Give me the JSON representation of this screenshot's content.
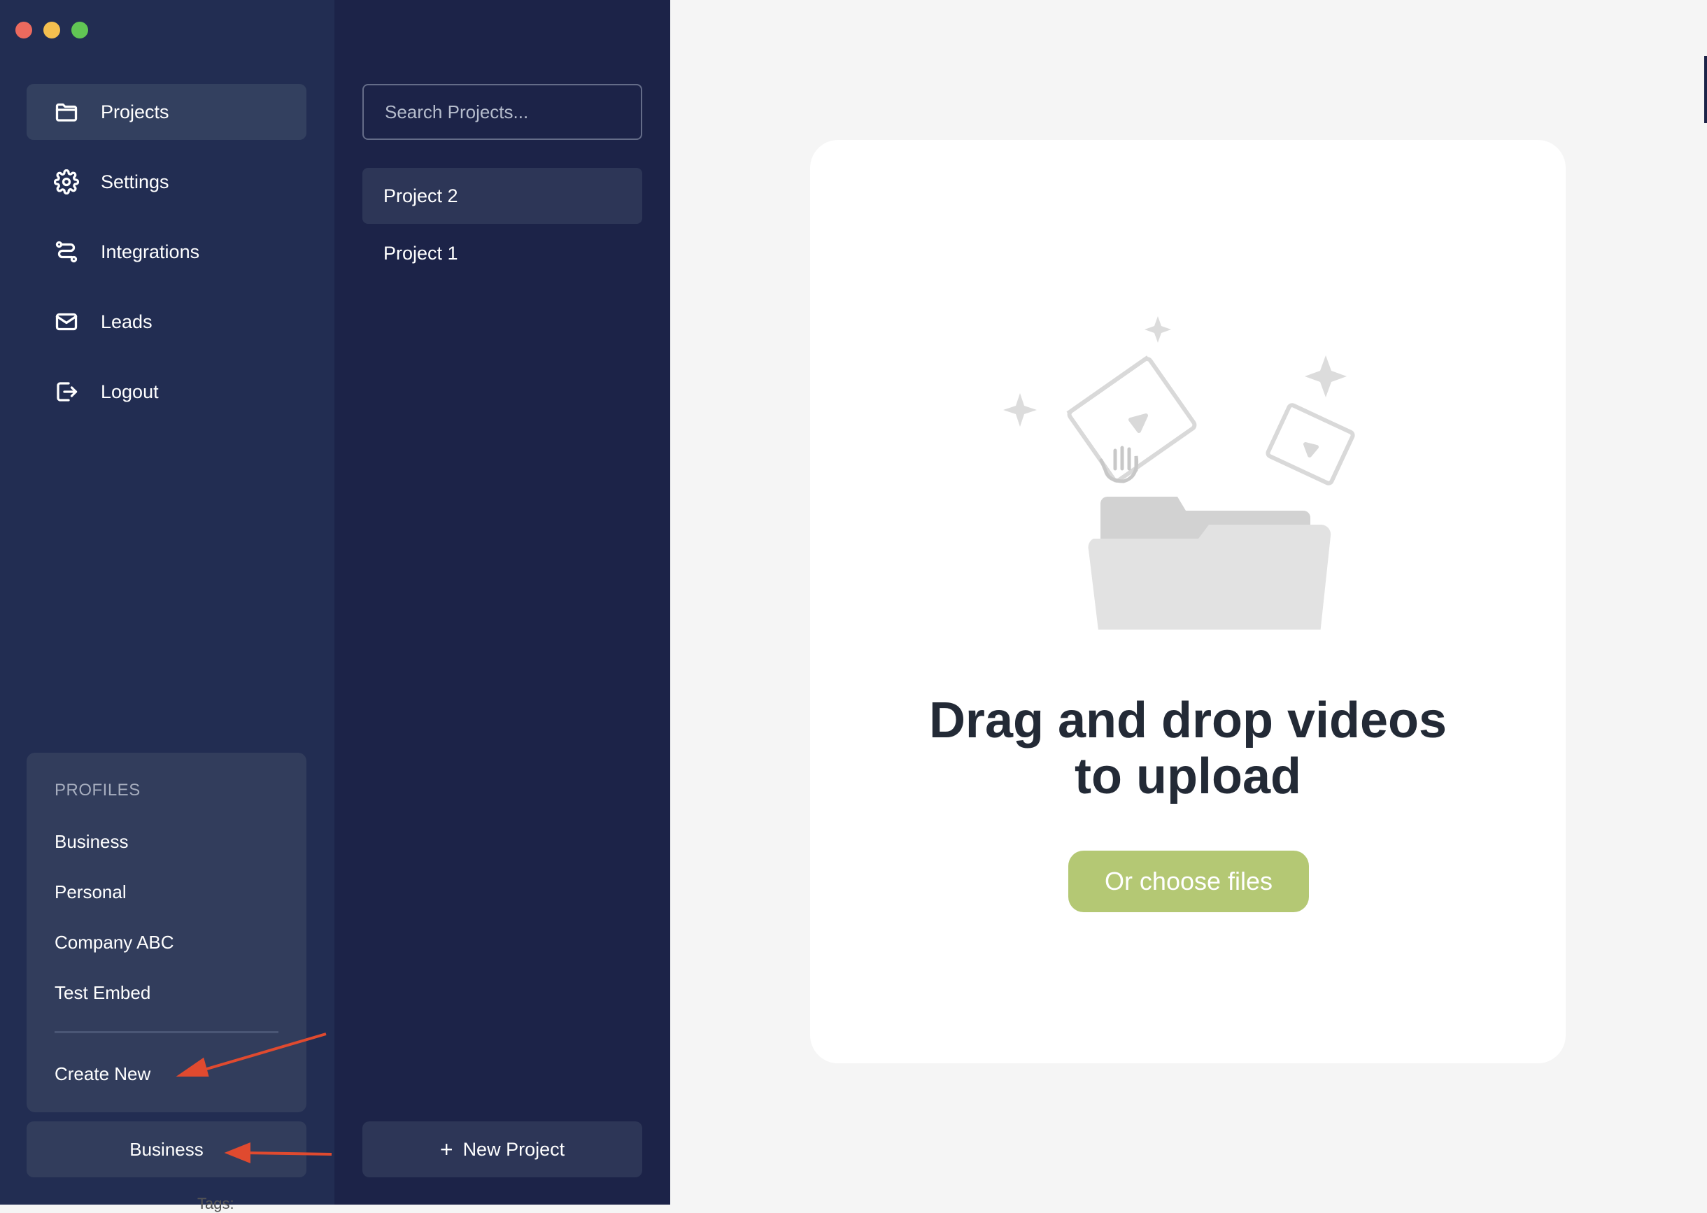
{
  "window": {
    "traffic_lights": [
      "close",
      "minimize",
      "zoom"
    ]
  },
  "sidebar": {
    "items": [
      {
        "label": "Projects",
        "icon": "folder-icon",
        "active": true
      },
      {
        "label": "Settings",
        "icon": "gear-icon",
        "active": false
      },
      {
        "label": "Integrations",
        "icon": "route-icon",
        "active": false
      },
      {
        "label": "Leads",
        "icon": "mail-icon",
        "active": false
      },
      {
        "label": "Logout",
        "icon": "logout-icon",
        "active": false
      }
    ],
    "profiles": {
      "title": "PROFILES",
      "items": [
        "Business",
        "Personal",
        "Company ABC",
        "Test Embed"
      ],
      "create_new": "Create New"
    },
    "current_profile": "Business"
  },
  "projects": {
    "search_placeholder": "Search Projects...",
    "items": [
      {
        "label": "Project 2",
        "active": true
      },
      {
        "label": "Project 1",
        "active": false
      }
    ],
    "new_project_label": "New Project"
  },
  "upload": {
    "headline_line1": "Drag and drop videos",
    "headline_line2": "to upload",
    "choose_button": "Or choose files"
  },
  "footer_partial_text": "Tags:",
  "colors": {
    "sidebar": "#222d52",
    "projects_column": "#1c2348",
    "accent_button": "#b4c874",
    "annotation_arrow": "#e04a2f"
  }
}
